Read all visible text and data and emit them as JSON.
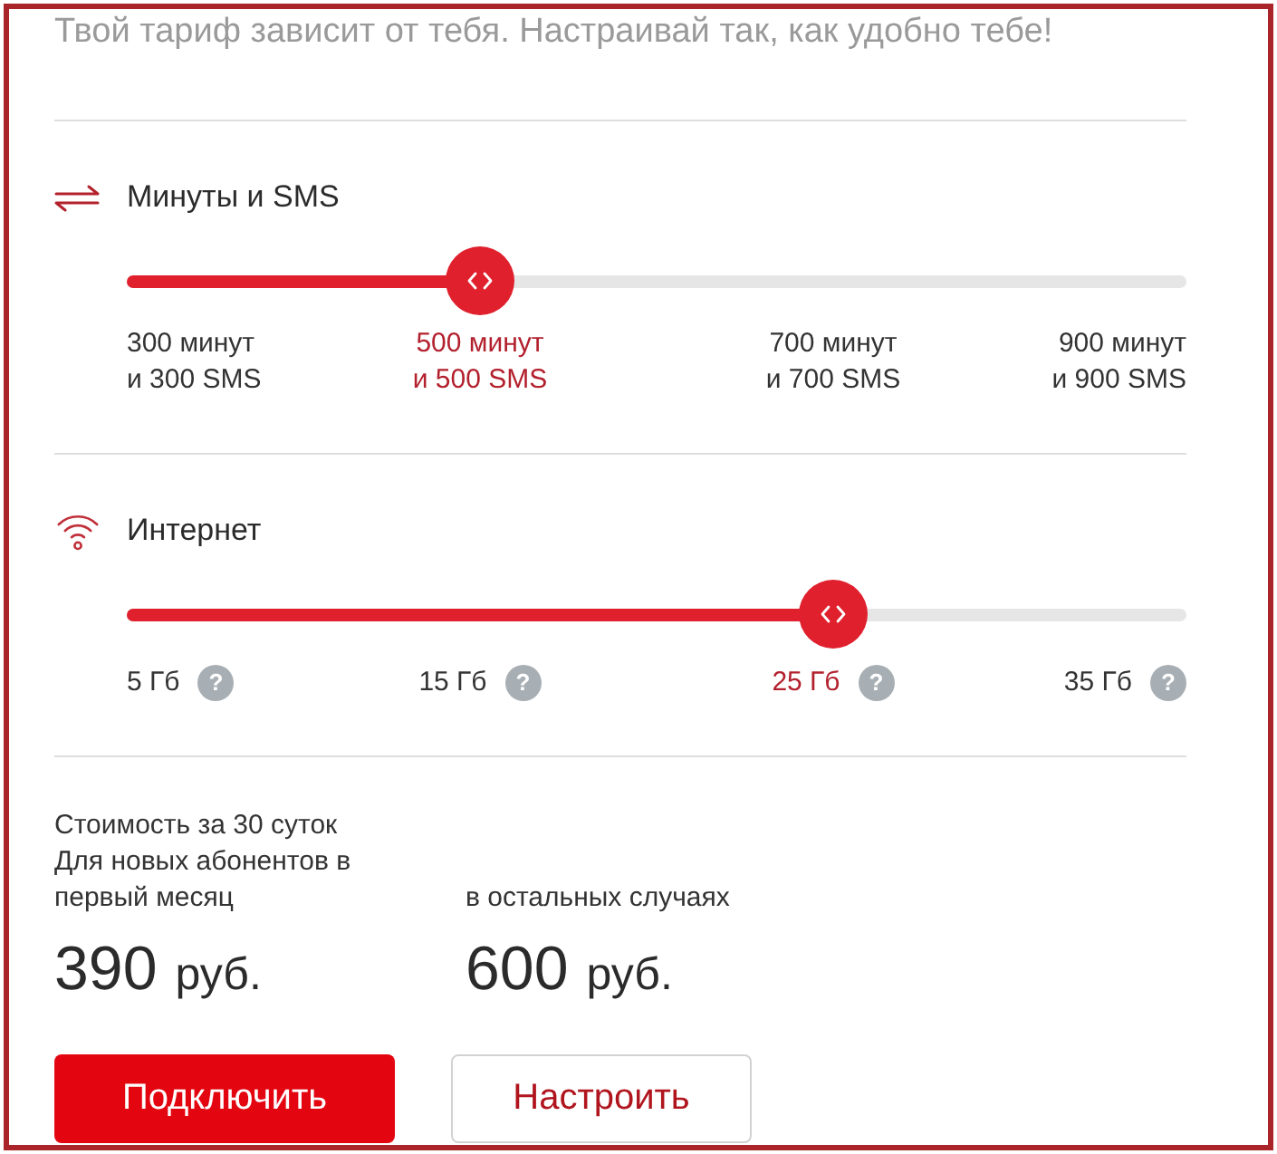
{
  "intro": "Твой тариф зависит от тебя. Настраивай так, как удобно тебе!",
  "sliders": [
    {
      "kind": "minutes",
      "title": "Минуты и SMS",
      "level": 0.333,
      "stops": [
        {
          "label": "300 минут\nи 300 SMS",
          "selected": false
        },
        {
          "label": "500 минут\nи 500 SMS",
          "selected": true
        },
        {
          "label": "700 минут\nи 700 SMS",
          "selected": false
        },
        {
          "label": "900 минут\nи 900 SMS",
          "selected": false
        }
      ]
    },
    {
      "kind": "internet",
      "title": "Интернет",
      "level": 0.667,
      "stops": [
        {
          "label": "5 Гб",
          "hint": "?",
          "selected": false
        },
        {
          "label": "15 Гб",
          "hint": "?",
          "selected": false
        },
        {
          "label": "25 Гб",
          "hint": "?",
          "selected": true
        },
        {
          "label": "35 Гб",
          "hint": "?",
          "selected": false
        }
      ]
    }
  ],
  "pricing": {
    "caption": "Стоимость за 30 суток",
    "prices": [
      {
        "condition": "Для новых абонентов в первый месяц",
        "amount": "390",
        "currency": "руб."
      },
      {
        "condition": "в остальных случаях",
        "amount": "600",
        "currency": "руб."
      }
    ]
  },
  "buttons": [
    {
      "kind": "primary",
      "label": "Подключить"
    },
    {
      "kind": "outline",
      "label": "Настроить"
    }
  ]
}
